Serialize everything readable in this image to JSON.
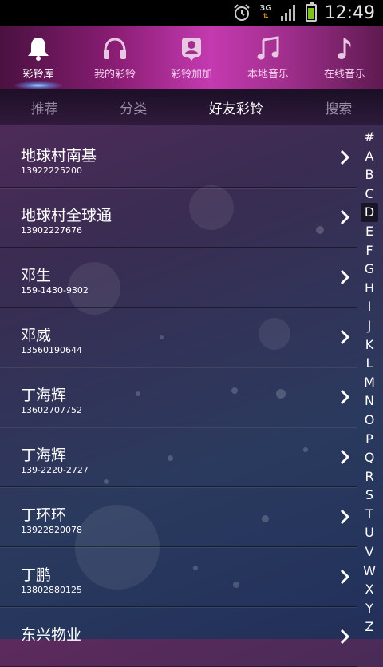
{
  "status_bar": {
    "network": "3G",
    "time": "12:49",
    "icons": [
      "alarm-icon",
      "network-3g-icon",
      "signal-icon",
      "battery-icon"
    ]
  },
  "top_tabs": [
    {
      "label": "彩铃库",
      "icon": "bell-icon",
      "active": true
    },
    {
      "label": "我的彩铃",
      "icon": "headphones-icon",
      "active": false
    },
    {
      "label": "彩铃加加",
      "icon": "contact-card-icon",
      "active": false
    },
    {
      "label": "本地音乐",
      "icon": "music-note-double-icon",
      "active": false
    },
    {
      "label": "在线音乐",
      "icon": "music-note-icon",
      "active": false
    }
  ],
  "sub_tabs": [
    {
      "label": "推荐",
      "active": false
    },
    {
      "label": "分类",
      "active": false
    },
    {
      "label": "好友彩铃",
      "active": true
    },
    {
      "label": "搜索",
      "active": false
    }
  ],
  "contacts": [
    {
      "name": "地球村南基",
      "number": "13922225200"
    },
    {
      "name": "地球村全球通",
      "number": "13902227676"
    },
    {
      "name": "邓生",
      "number": "159-1430-9302"
    },
    {
      "name": "邓威",
      "number": "13560190644"
    },
    {
      "name": "丁海辉",
      "number": "13602707752"
    },
    {
      "name": "丁海辉",
      "number": "139-2220-2727"
    },
    {
      "name": "丁环环",
      "number": "13922820078"
    },
    {
      "name": "丁鹏",
      "number": "13802880125"
    },
    {
      "name": "东兴物业",
      "number": ""
    }
  ],
  "index_letters": [
    "#",
    "A",
    "B",
    "C",
    "D",
    "E",
    "F",
    "G",
    "H",
    "I",
    "J",
    "K",
    "L",
    "M",
    "N",
    "O",
    "P",
    "Q",
    "R",
    "S",
    "T",
    "U",
    "V",
    "W",
    "X",
    "Y",
    "Z"
  ],
  "index_selected": "D",
  "colors": {
    "accent": "#c43ab0",
    "battery": "#7ec21e",
    "network_arrows": "#f0a020"
  }
}
